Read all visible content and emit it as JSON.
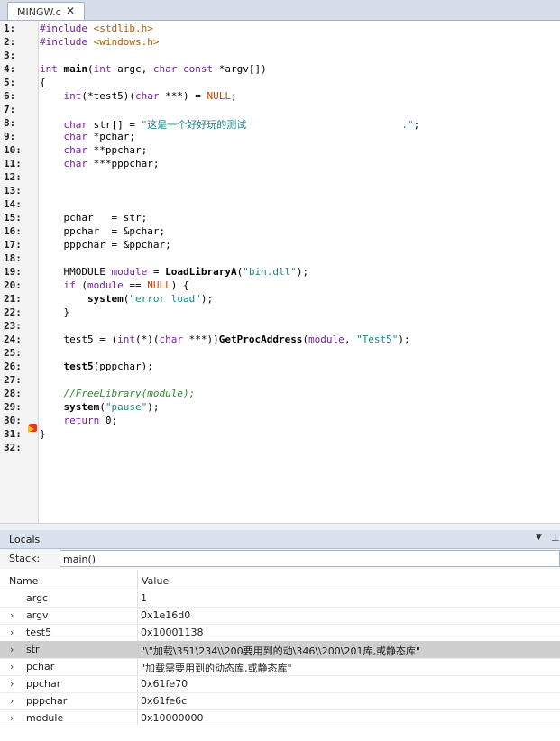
{
  "tab": {
    "label": "MINGW.c",
    "close": "✕"
  },
  "editor": {
    "lines": [
      {
        "n": "1:",
        "html": "<span class=\"pp\">#include</span> <span class=\"inc\">&lt;stdlib.h&gt;</span>"
      },
      {
        "n": "2:",
        "html": "<span class=\"pp\">#include</span> <span class=\"inc\">&lt;windows.h&gt;</span>"
      },
      {
        "n": "3:",
        "html": ""
      },
      {
        "n": "4:",
        "html": "<span class=\"kw\">int</span> <span class=\"fn\">main</span>(<span class=\"kw\">int</span> argc, <span class=\"kw\">char const</span> *argv[])"
      },
      {
        "n": "5:",
        "html": "{"
      },
      {
        "n": "6:",
        "html": "    <span class=\"kw\">int</span>(*test5)(<span class=\"kw\">char</span> ***) = <span class=\"nul\">NULL</span>;"
      },
      {
        "n": "7:",
        "html": ""
      },
      {
        "n": "8:",
        "html": "    <span class=\"kw\">char</span> str[] = <span class=\"str\">\"这是一个好好玩的测试                          .\"</span>;"
      },
      {
        "n": "9:",
        "html": "    <span class=\"kw\">char</span> *pchar;"
      },
      {
        "n": "10:",
        "html": "    <span class=\"kw\">char</span> **ppchar;"
      },
      {
        "n": "11:",
        "html": "    <span class=\"kw\">char</span> ***pppchar;"
      },
      {
        "n": "12:",
        "html": ""
      },
      {
        "n": "13:",
        "html": ""
      },
      {
        "n": "14:",
        "html": ""
      },
      {
        "n": "15:",
        "html": "    pchar   = str;"
      },
      {
        "n": "16:",
        "html": "    ppchar  = &amp;pchar;"
      },
      {
        "n": "17:",
        "html": "    pppchar = &amp;ppchar;"
      },
      {
        "n": "18:",
        "html": ""
      },
      {
        "n": "19:",
        "html": "    HMODULE <span class=\"kw\">module</span> = <span class=\"fn\">LoadLibraryA</span>(<span class=\"str\">\"bin.dll\"</span>);"
      },
      {
        "n": "20:",
        "html": "    <span class=\"kw\">if</span> (<span class=\"kw\">module</span> == <span class=\"nul\">NULL</span>) {"
      },
      {
        "n": "21:",
        "html": "        <span class=\"fn\">system</span>(<span class=\"str\">\"error load\"</span>);"
      },
      {
        "n": "22:",
        "html": "    }"
      },
      {
        "n": "23:",
        "html": ""
      },
      {
        "n": "24:",
        "html": "    test5 = (<span class=\"kw\">int</span>(*)(<span class=\"kw\">char</span> ***))<span class=\"fn\">GetProcAddress</span>(<span class=\"kw\">module</span>, <span class=\"str\">\"Test5\"</span>);"
      },
      {
        "n": "25:",
        "html": ""
      },
      {
        "n": "26:",
        "html": "    <span class=\"fn\">test5</span>(pppchar);"
      },
      {
        "n": "27:",
        "html": ""
      },
      {
        "n": "28:",
        "html": "    <span class=\"cmt\">//FreeLibrary(module);</span>"
      },
      {
        "n": "29:",
        "html": "    <span class=\"fn\">system</span>(<span class=\"str\">\"pause\"</span>);"
      },
      {
        "n": "30:",
        "html": "    <span class=\"kw\">return</span> 0;"
      },
      {
        "n": "31:",
        "html": "}"
      },
      {
        "n": "32:",
        "html": ""
      }
    ]
  },
  "locals": {
    "title": "Locals",
    "dropdown_icon": "▼",
    "pin_icon": "⊥",
    "stack_label": "Stack:",
    "stack_value": "main()",
    "col_name": "Name",
    "col_value": "Value",
    "rows": [
      {
        "name": "argc",
        "value": "1",
        "expandable": false,
        "selected": false
      },
      {
        "name": "argv",
        "value": "0x1e16d0",
        "expandable": true,
        "selected": false
      },
      {
        "name": "test5",
        "value": "0x10001138",
        "expandable": true,
        "selected": false
      },
      {
        "name": "str",
        "value": "\"\\\"加载\\351\\234\\\\200要用到的动\\346\\\\200\\201库,或静态库\"",
        "expandable": true,
        "selected": true
      },
      {
        "name": "pchar",
        "value": "\"加载需要用到的动态库,或静态库\"",
        "expandable": true,
        "selected": false
      },
      {
        "name": "ppchar",
        "value": "0x61fe70",
        "expandable": true,
        "selected": false
      },
      {
        "name": "pppchar",
        "value": "0x61fe6c",
        "expandable": true,
        "selected": false
      },
      {
        "name": "module",
        "value": "0x10000000",
        "expandable": true,
        "selected": false
      }
    ]
  }
}
